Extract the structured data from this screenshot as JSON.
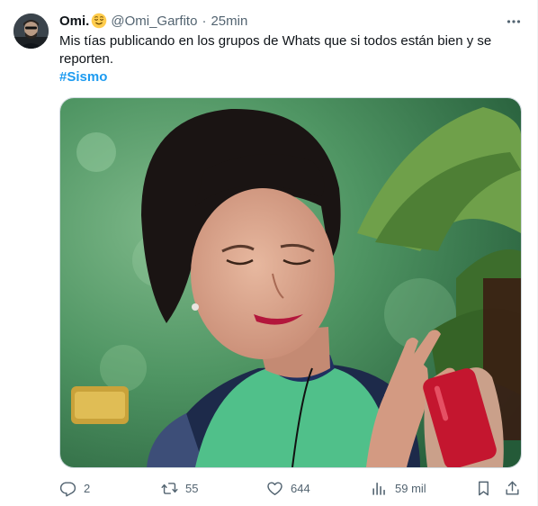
{
  "tweet": {
    "display_name": "Omi.",
    "handle": "@Omi_Garfito",
    "separator": "·",
    "time": "25min",
    "text": "Mis tías publicando en los grupos de Whats que si todos están bien y se reporten.",
    "hashtag": "#Sismo",
    "media_alt": "",
    "icons": {
      "avatar": "avatar-image",
      "emoji": "relieved-face-emoji",
      "more": "more-icon"
    }
  },
  "actions": {
    "reply": {
      "count": "2",
      "icon": "reply-icon"
    },
    "retweet": {
      "count": "55",
      "icon": "retweet-icon"
    },
    "like": {
      "count": "644",
      "icon": "heart-icon"
    },
    "views": {
      "count": "59 mil",
      "icon": "views-icon"
    },
    "bookmark": {
      "icon": "bookmark-icon"
    },
    "share": {
      "icon": "share-icon"
    }
  },
  "colors": {
    "text": "#0f1419",
    "secondary": "#536471",
    "accent": "#1d9bf0",
    "border": "#cfd9de"
  }
}
